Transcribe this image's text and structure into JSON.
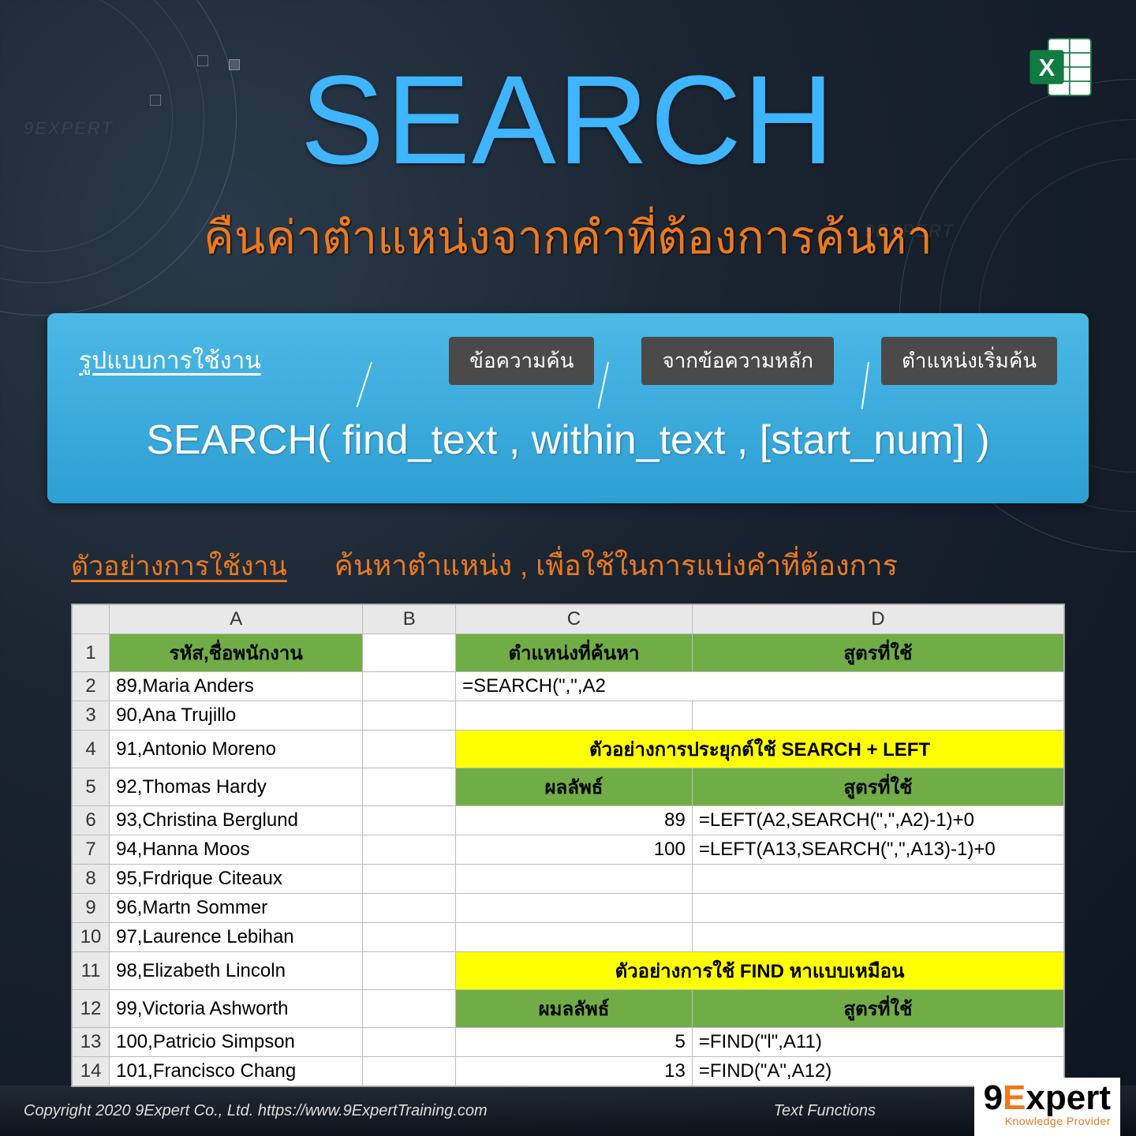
{
  "watermark": "9EXPERT",
  "title": "SEARCH",
  "subtitle": "คืนค่าตำแหน่งจากคำที่ต้องการค้นหา",
  "syntax": {
    "usage_label": "รูปแบบการใช้งาน",
    "callout1": "ข้อความค้น",
    "callout2": "จากข้อความหลัก",
    "callout3": "ตำแหน่งเริ่มค้น",
    "formula": "SEARCH( find_text , within_text , [start_num] )"
  },
  "example": {
    "label": "ตัวอย่างการใช้งาน",
    "desc": "ค้นหาตำแหน่ง , เพื่อใช้ในการแบ่งคำที่ต้องการ"
  },
  "sheet": {
    "colA": "A",
    "colB": "B",
    "colC": "C",
    "colD": "D",
    "headerA": "รหัส,ชื่อพนักงาน",
    "headerC": "ตำแหน่งที่ค้นหา",
    "headerD": "สูตรที่ใช้",
    "rows": [
      "89,Maria Anders",
      "90,Ana Trujillo",
      "91,Antonio Moreno",
      "92,Thomas Hardy",
      "93,Christina Berglund",
      "94,Hanna Moos",
      "95,Frdrique Citeaux",
      "96,Martn Sommer",
      "97,Laurence Lebihan",
      "98,Elizabeth Lincoln",
      "99,Victoria Ashworth",
      "100,Patricio Simpson",
      "101,Francisco Chang"
    ],
    "search_formula": "=SEARCH(\",\",A2",
    "yellow1": "ตัวอย่างการประยุกต์ใช้ SEARCH + LEFT",
    "green_result": "ผลลัพธ์",
    "green_formula": "สูตรที่ใช้",
    "r1c": "89",
    "r1d": "=LEFT(A2,SEARCH(\",\",A2)-1)+0",
    "r2c": "100",
    "r2d": "=LEFT(A13,SEARCH(\",\",A13)-1)+0",
    "yellow2": "ตัวอย่างการใช้ FIND หาแบบเหมือน",
    "green_result2": "ผมลลัพธ์",
    "r3c": "5",
    "r3d": "=FIND(\"l\",A11)",
    "r4c": "13",
    "r4d": "=FIND(\"A\",A12)"
  },
  "footer": {
    "copyright": "Copyright 2020 9Expert Co., Ltd.   https://www.9ExpertTraining.com",
    "category": "Text Functions",
    "logo_main": "9",
    "logo_e": "E",
    "logo_rest": "xpert",
    "logo_sub": "Knowledge Provider"
  }
}
